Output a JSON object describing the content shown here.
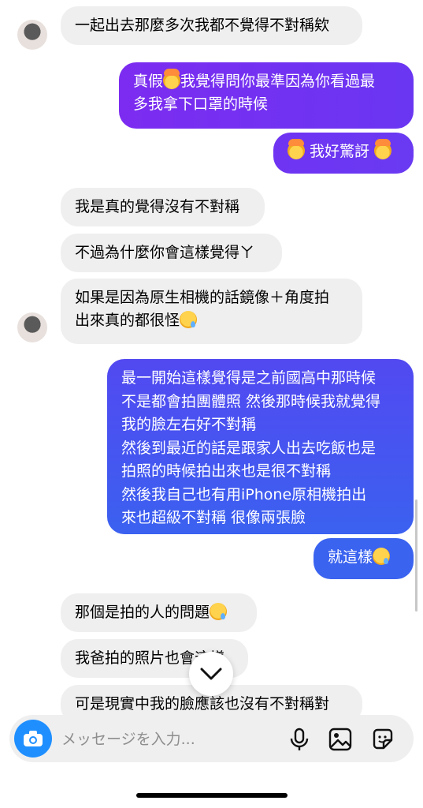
{
  "messages": [
    {
      "side": "in",
      "text": "一起出去那麼多次我都不覺得不對稱欸"
    },
    {
      "side": "out",
      "line1a": "真假",
      "line1b": "我覺得問你最準因為你看過最",
      "line2": "多我拿下口罩的時候",
      "emoji": "exploding-head-emoji"
    },
    {
      "side": "out",
      "text": "我好驚訝",
      "emoji": "exploding-head-emoji"
    },
    {
      "side": "in",
      "text": "我是真的覺得沒有不對稱"
    },
    {
      "side": "in",
      "text": "不過為什麼你會這樣覺得ㄚ"
    },
    {
      "side": "in",
      "line1": "如果是因為原生相機的話鏡像＋角度拍",
      "line2": "出來真的都很怪",
      "emoji": "crying-face-emoji"
    },
    {
      "side": "out",
      "lines": [
        "最一開始這樣覺得是之前國高中那時候",
        "不是都會拍團體照 然後那時候我就覺得",
        "我的臉左右好不對稱",
        "然後到最近的話是跟家人出去吃飯也是",
        "拍照的時候拍出來也是很不對稱",
        "然後我自己也有用iPhone原相機拍出",
        "來也超級不對稱 很像兩張臉"
      ]
    },
    {
      "side": "out",
      "text": "就這樣",
      "emoji": "crying-face-emoji"
    },
    {
      "side": "in",
      "text": "那個是拍的人的問題",
      "emoji": "crying-face-emoji"
    },
    {
      "side": "in",
      "text": "我爸拍的照片也會這樣"
    },
    {
      "side": "in",
      "text": "可是現實中我的臉應該也沒有不對稱對"
    }
  ],
  "composer": {
    "placeholder": "メッセージを入力...",
    "icons": [
      "camera-icon",
      "microphone-icon",
      "gallery-icon",
      "sticker-icon"
    ]
  },
  "colors": {
    "incoming": "#efefef",
    "outgoing_purple": "#7b2ff0",
    "outgoing_blue": "#3a63f0",
    "camera_button": "#1f8fff"
  }
}
